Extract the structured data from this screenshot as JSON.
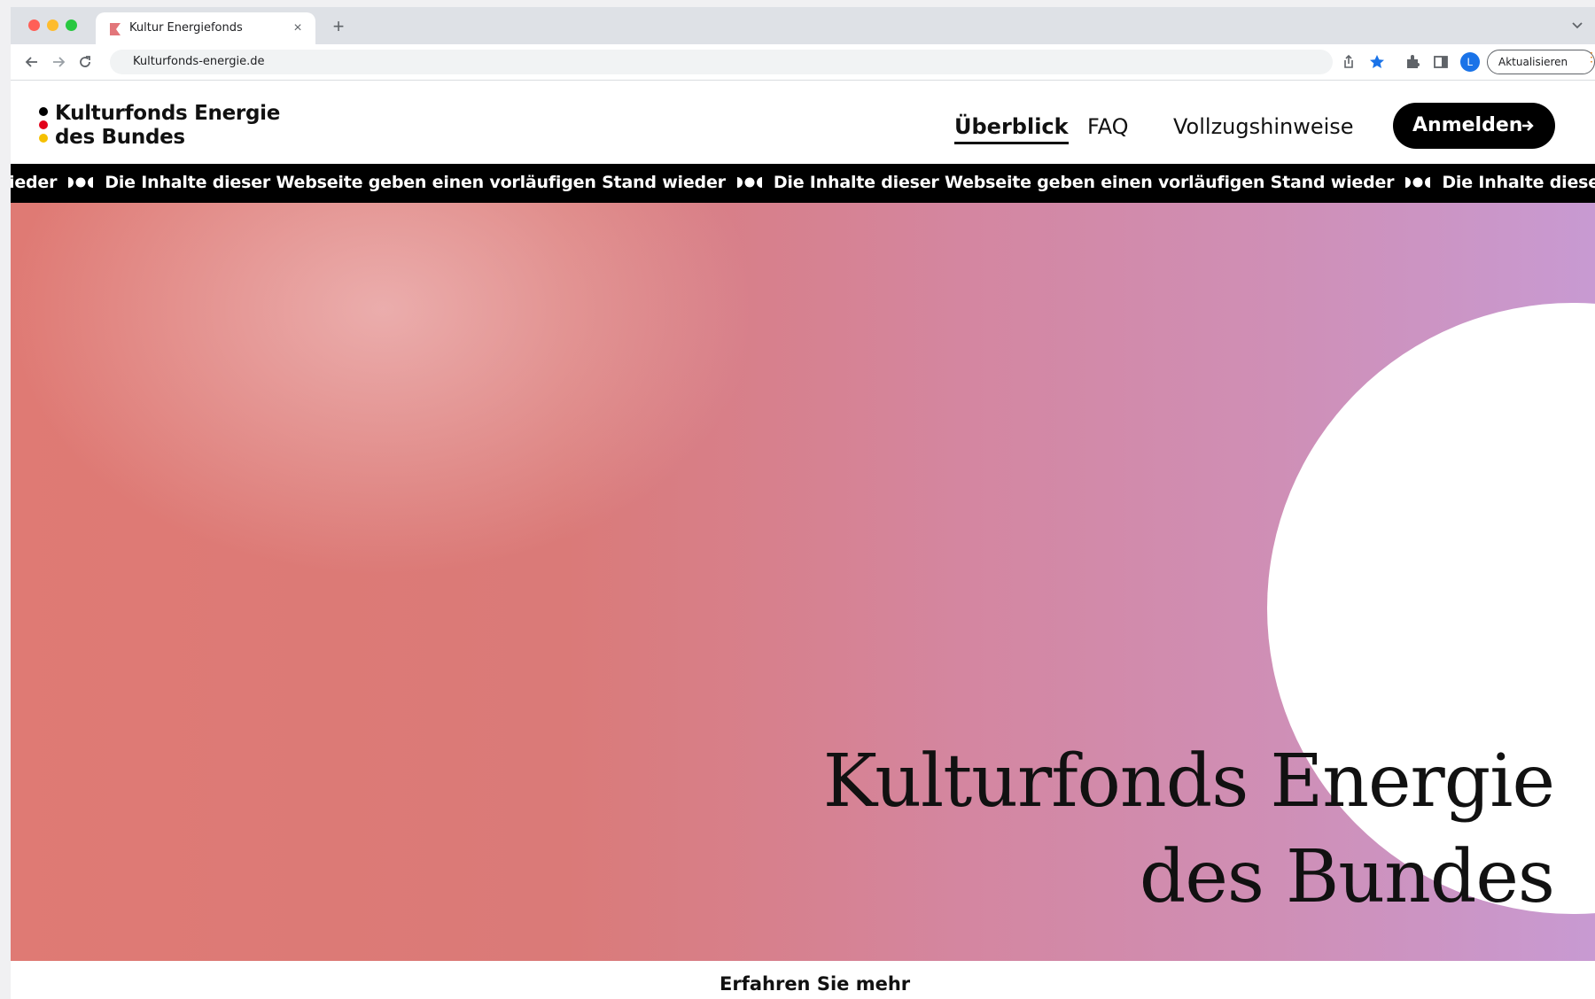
{
  "browser": {
    "tab_title": "Kultur Energiefonds",
    "tab_close": "×",
    "new_tab": "+",
    "url": "Kulturfonds-energie.de",
    "profile_initial": "L",
    "update_label": "Aktualisieren",
    "update_dots": "⋮"
  },
  "site": {
    "logo_line1": "Kulturfonds Energie",
    "logo_line2": "des Bundes",
    "nav": [
      {
        "label": "Überblick"
      },
      {
        "label": "FAQ"
      },
      {
        "label": "Vollzugshinweise"
      }
    ],
    "cta_label": "Anmelden",
    "ticker": {
      "lead": "ieder",
      "message": "Die Inhalte dieser Webseite geben einen vorläufigen Stand wieder",
      "tail": "Die Inhalte dieser Webseite geben einen vorläufi"
    },
    "hero_title_line1": "Kulturfonds Energie",
    "hero_title_line2": "des Bundes",
    "more_label": "Erfahren Sie mehr"
  },
  "colors": {
    "logo_dots": [
      "#000000",
      "#e2001a",
      "#f5c000"
    ],
    "hero_gradient": [
      "#df7a74",
      "#c89ad2"
    ],
    "update_accent": "#e37400"
  },
  "icons": [
    "back-arrow-icon",
    "forward-arrow-icon",
    "reload-icon",
    "share-icon",
    "star-icon",
    "extensions-icon",
    "sidepanel-icon",
    "chevron-down-icon",
    "arrow-right-icon",
    "ticker-separator-icon"
  ]
}
